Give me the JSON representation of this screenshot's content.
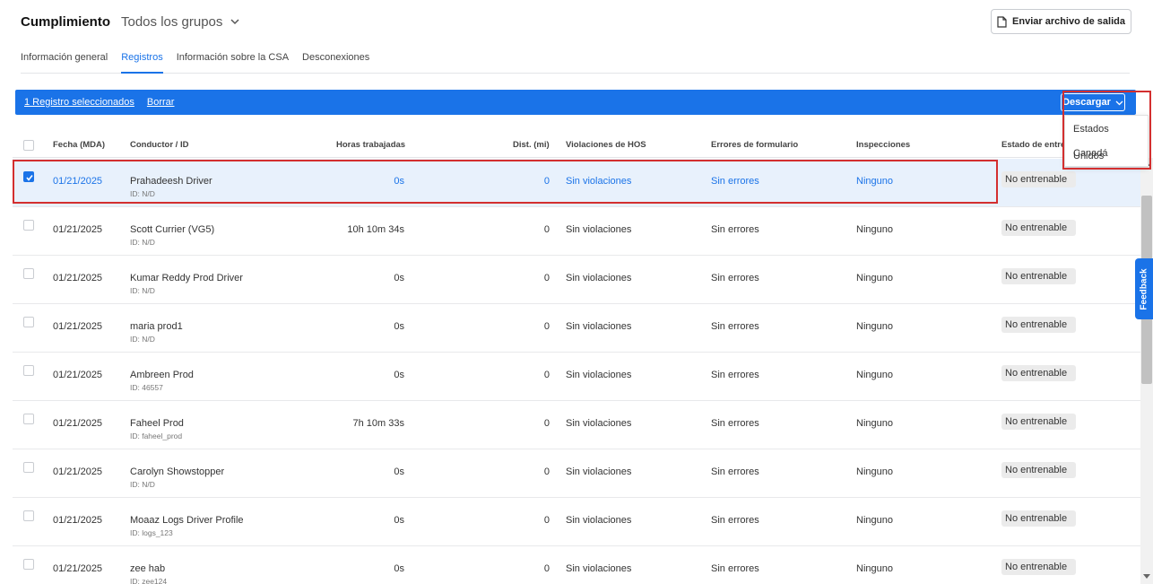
{
  "header": {
    "title": "Cumplimiento",
    "group_selector": "Todos los grupos",
    "send_button": "Enviar archivo de salida"
  },
  "tabs": [
    {
      "label": "Información general",
      "active": false
    },
    {
      "label": "Registros",
      "active": true
    },
    {
      "label": "Información sobre la CSA",
      "active": false
    },
    {
      "label": "Desconexiones",
      "active": false
    }
  ],
  "selection_bar": {
    "selected_text": "1 Registro seleccionados",
    "clear_label": "Borrar",
    "download_label": "Descargar",
    "download_options": [
      "Estados Unidos",
      "Canadá"
    ]
  },
  "table": {
    "columns": [
      "Fecha (MDA)",
      "Conductor / ID",
      "Horas trabajadas",
      "Dist. (mi)",
      "Violaciones de HOS",
      "Errores de formulario",
      "Inspecciones",
      "Estado de entre"
    ],
    "rows": [
      {
        "selected": true,
        "date": "01/21/2025",
        "driver": "Prahadeesh Driver",
        "id": "ID: N/D",
        "hours": "0s",
        "dist": "0",
        "hos": "Sin violaciones",
        "errors": "Sin errores",
        "inspections": "Ninguno",
        "status": "No entrenable"
      },
      {
        "selected": false,
        "date": "01/21/2025",
        "driver": "Scott Currier (VG5)",
        "id": "ID: N/D",
        "hours": "10h 10m 34s",
        "dist": "0",
        "hos": "Sin violaciones",
        "errors": "Sin errores",
        "inspections": "Ninguno",
        "status": "No entrenable"
      },
      {
        "selected": false,
        "date": "01/21/2025",
        "driver": "Kumar Reddy Prod Driver",
        "id": "ID: N/D",
        "hours": "0s",
        "dist": "0",
        "hos": "Sin violaciones",
        "errors": "Sin errores",
        "inspections": "Ninguno",
        "status": "No entrenable"
      },
      {
        "selected": false,
        "date": "01/21/2025",
        "driver": "maria prod1",
        "id": "ID: N/D",
        "hours": "0s",
        "dist": "0",
        "hos": "Sin violaciones",
        "errors": "Sin errores",
        "inspections": "Ninguno",
        "status": "No entrenable"
      },
      {
        "selected": false,
        "date": "01/21/2025",
        "driver": "Ambreen Prod",
        "id": "ID: 46557",
        "hours": "0s",
        "dist": "0",
        "hos": "Sin violaciones",
        "errors": "Sin errores",
        "inspections": "Ninguno",
        "status": "No entrenable"
      },
      {
        "selected": false,
        "date": "01/21/2025",
        "driver": "Faheel Prod",
        "id": "ID: faheel_prod",
        "hours": "7h 10m 33s",
        "dist": "0",
        "hos": "Sin violaciones",
        "errors": "Sin errores",
        "inspections": "Ninguno",
        "status": "No entrenable"
      },
      {
        "selected": false,
        "date": "01/21/2025",
        "driver": "Carolyn Showstopper",
        "id": "ID: N/D",
        "hours": "0s",
        "dist": "0",
        "hos": "Sin violaciones",
        "errors": "Sin errores",
        "inspections": "Ninguno",
        "status": "No entrenable"
      },
      {
        "selected": false,
        "date": "01/21/2025",
        "driver": "Moaaz Logs Driver Profile",
        "id": "ID: logs_123",
        "hours": "0s",
        "dist": "0",
        "hos": "Sin violaciones",
        "errors": "Sin errores",
        "inspections": "Ninguno",
        "status": "No entrenable"
      },
      {
        "selected": false,
        "date": "01/21/2025",
        "driver": "zee hab",
        "id": "ID: zee124",
        "hours": "0s",
        "dist": "0",
        "hos": "Sin violaciones",
        "errors": "Sin errores",
        "inspections": "Ninguno",
        "status": "No entrenable"
      }
    ]
  },
  "feedback_label": "Feedback",
  "colors": {
    "accent": "#1a73e8",
    "highlight_box": "#d32f2f",
    "selected_row": "#e8f1fc"
  }
}
